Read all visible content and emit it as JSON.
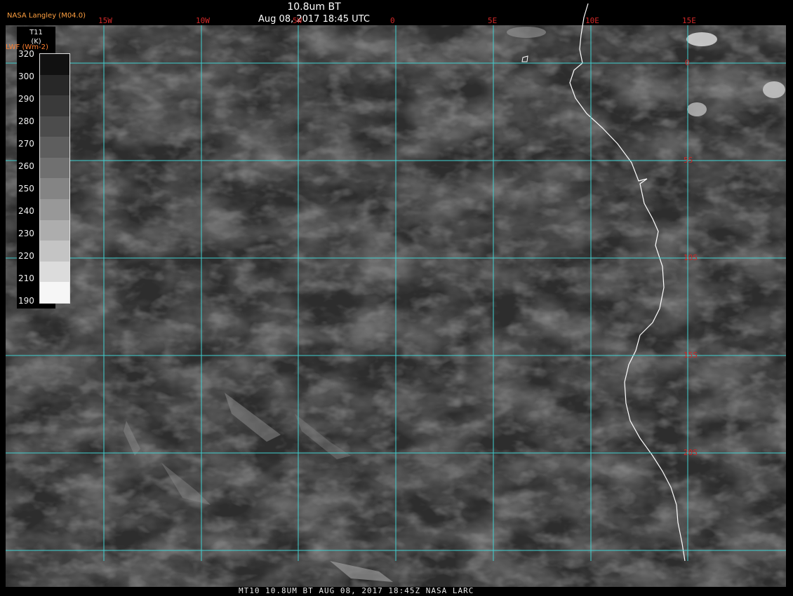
{
  "header": {
    "title": "10.8um BT",
    "datetime": "Aug 08, 2017 18:45 UTC",
    "credit": "NASA Langley (M04.0)",
    "lwf_label": "LWF (Wm-2)"
  },
  "colorbar": {
    "variable": "T11",
    "unit": "(K)",
    "ticks": [
      "320",
      "300",
      "290",
      "280",
      "270",
      "260",
      "250",
      "240",
      "230",
      "220",
      "210",
      "190"
    ],
    "colors": [
      "#111111",
      "#282828",
      "#3a3a3a",
      "#4c4c4c",
      "#5e5e5e",
      "#707070",
      "#848484",
      "#989898",
      "#adadad",
      "#c4c4c4",
      "#dcdcdc",
      "#f6f6f6"
    ]
  },
  "grid": {
    "longitudes": [
      "15W",
      "10W",
      "5W",
      "0",
      "5E",
      "10E",
      "15E"
    ],
    "latitudes": [
      "0",
      "5S",
      "10S",
      "15S",
      "20S"
    ],
    "line_color": "#40d0d0",
    "label_color": "#d02828"
  },
  "footer": {
    "text": "MT10   10.8UM BT   AUG 08, 2017 18:45Z   NASA LARC"
  }
}
